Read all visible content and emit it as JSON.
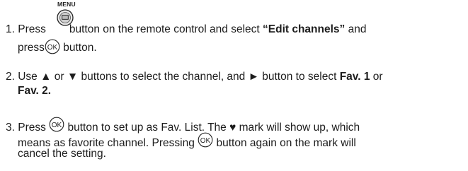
{
  "menu_icon_label": "MENU",
  "step1": {
    "num": "1. Press",
    "after_icon": "button on the remote control and select",
    "quoted": "“Edit channels”",
    "and": "and",
    "press": "press",
    "ok_label": "OK",
    "end": "button."
  },
  "step2": {
    "line1_a": "2. Use ▲ or ▼ buttons to select the channel, and ► button to select",
    "fav1": "Fav. 1",
    "or": "or",
    "fav2": "Fav. 2",
    "period": "."
  },
  "step3": {
    "num": "3. Press",
    "after_ok": "button to set up as Fav. List. The ♥ mark will show up, which",
    "line2_a": "means as favorite channel. Pressing",
    "line2_b": "button again on the mark will",
    "line3": "cancel the setting."
  }
}
